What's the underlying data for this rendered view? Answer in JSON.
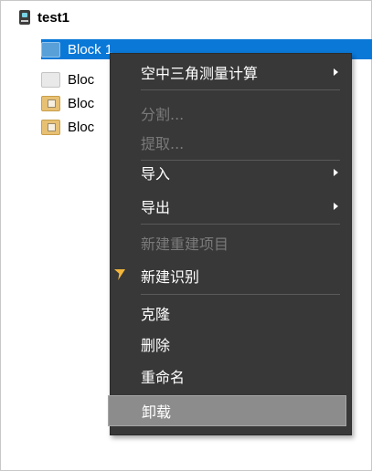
{
  "tree": {
    "root": {
      "label": "test1",
      "icon": "project-root-icon"
    },
    "items": [
      {
        "label": "Block 1",
        "icon": "folder-blue-icon",
        "selected": true
      },
      {
        "label": "Bloc",
        "icon": "folder-gray-icon"
      },
      {
        "label": "Bloc",
        "icon": "folder-yellow-icon"
      },
      {
        "label": "Bloc",
        "icon": "folder-yellow-icon"
      }
    ]
  },
  "menu": {
    "items": [
      {
        "label": "空中三角测量计算",
        "enabled": true,
        "submenu": true
      },
      {
        "label": "分割...",
        "enabled": false
      },
      {
        "label": "提取...",
        "enabled": false
      },
      {
        "label": "导入",
        "enabled": true,
        "submenu": true
      },
      {
        "label": "导出",
        "enabled": true,
        "submenu": true
      },
      {
        "label": "新建重建项目",
        "enabled": false
      },
      {
        "label": "新建识别",
        "enabled": true,
        "icon": "yellow-flag-icon"
      },
      {
        "label": "克隆",
        "enabled": true
      },
      {
        "label": "删除",
        "enabled": true
      },
      {
        "label": "重命名",
        "enabled": true
      },
      {
        "label": "卸载",
        "enabled": true,
        "highlighted": true
      }
    ]
  },
  "colors": {
    "selection": "#0a78d7",
    "menu_background": "#383838",
    "menu_disabled_text": "#7a7a7a",
    "menu_highlight": "#8c8c8c"
  }
}
